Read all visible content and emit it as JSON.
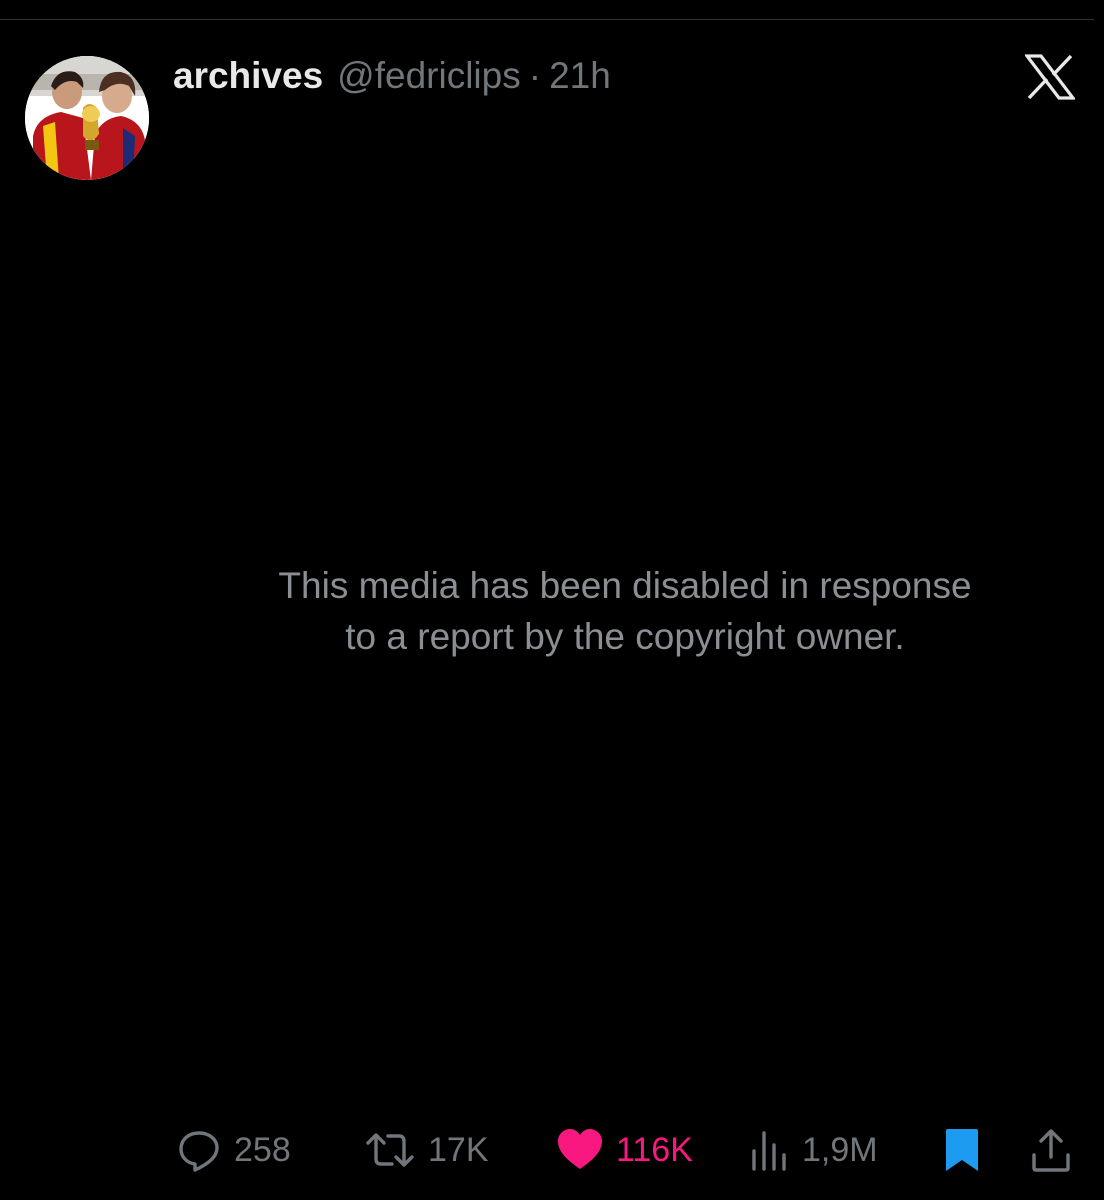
{
  "post": {
    "author": {
      "display_name": "archives",
      "handle": "@fedriclips",
      "separator": "·",
      "time": "21h",
      "avatar": "profile-photo"
    },
    "platform_icon": "x-logo-icon",
    "media_notice": {
      "line1": "This media has been disabled in response",
      "line2": "to a report by the copyright owner."
    }
  },
  "actions": {
    "reply": {
      "icon": "reply-icon",
      "count": "258"
    },
    "repost": {
      "icon": "repost-icon",
      "count": "17K"
    },
    "like": {
      "icon": "heart-icon",
      "count": "116K",
      "color": "#f91880"
    },
    "views": {
      "icon": "views-icon",
      "count": "1,9M"
    },
    "bookmark": {
      "icon": "bookmark-icon",
      "color": "#1d9bf0"
    },
    "share": {
      "icon": "share-icon"
    }
  },
  "colors": {
    "background": "#000000",
    "primary_text": "#e7e9ea",
    "secondary_text": "#71767b",
    "notice_text": "#8b8f94",
    "like_accent": "#f91880",
    "bookmark_accent": "#1d9bf0"
  }
}
